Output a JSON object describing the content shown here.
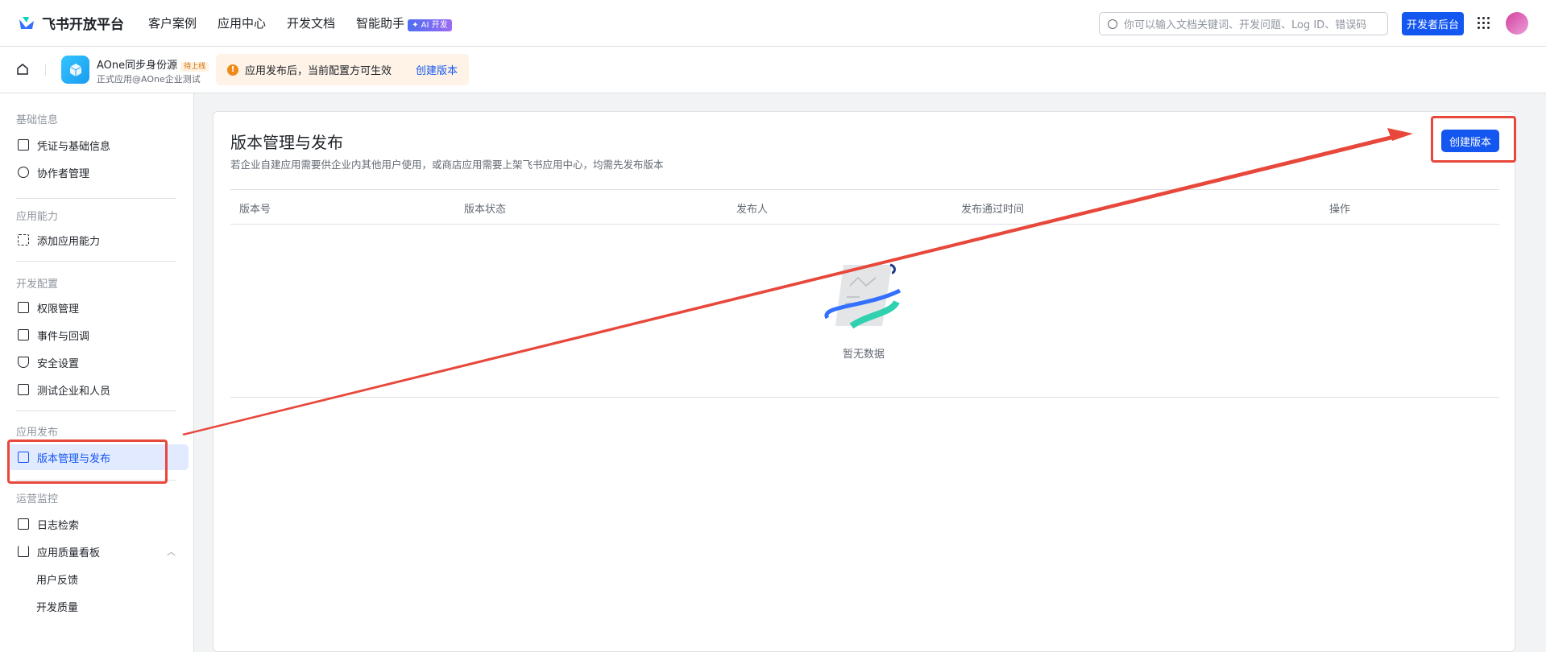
{
  "header": {
    "brand": "飞书开放平台",
    "nav": [
      "客户案例",
      "应用中心",
      "开发文档",
      "智能助手"
    ],
    "ai_badge": "✦ AI 开发",
    "search_placeholder": "你可以输入文档关键词、开发问题、Log ID、错误码",
    "dev_console": "开发者后台"
  },
  "app": {
    "name": "AOne同步身份源",
    "status": "待上线",
    "subtitle": "正式应用@AOne企业测试",
    "notice": "应用发布后，当前配置方可生效",
    "notice_link": "创建版本"
  },
  "sidebar": {
    "sections": [
      "基础信息",
      "应用能力",
      "开发配置",
      "应用发布",
      "运营监控"
    ],
    "items": [
      "凭证与基础信息",
      "协作者管理",
      "添加应用能力",
      "权限管理",
      "事件与回调",
      "安全设置",
      "测试企业和人员",
      "版本管理与发布",
      "日志检索",
      "应用质量看板",
      "用户反馈",
      "开发质量"
    ]
  },
  "main": {
    "title": "版本管理与发布",
    "subtitle": "若企业自建应用需要供企业内其他用户使用，或商店应用需要上架飞书应用中心，均需先发布版本",
    "create_button": "创建版本",
    "columns": [
      "版本号",
      "版本状态",
      "发布人",
      "发布通过时间",
      "操作"
    ],
    "empty": "暂无数据"
  },
  "colors": {
    "accent": "#1456f0",
    "annotation": "#e8473b"
  }
}
